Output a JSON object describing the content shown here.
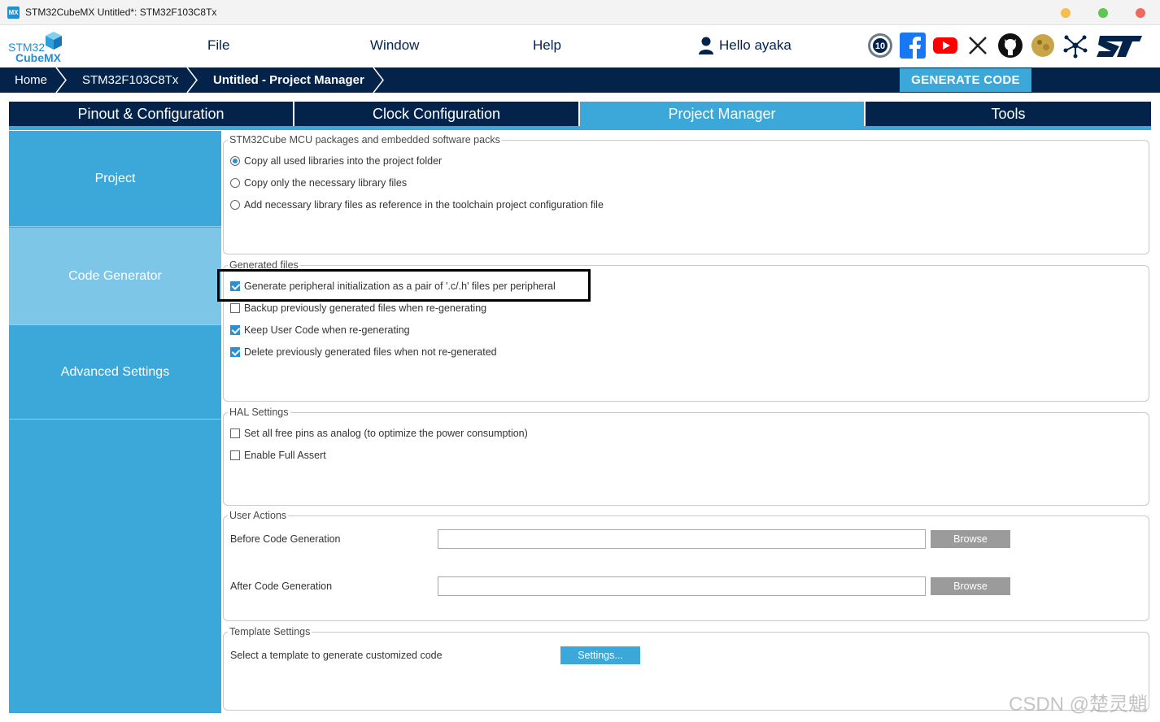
{
  "window": {
    "title": "STM32CubeMX Untitled*: STM32F103C8Tx",
    "icon_text": "MX",
    "controls": {
      "minimize_color": "#f5bf4f",
      "maximize_color": "#61c554",
      "close_color": "#ed6a5e"
    }
  },
  "logo": {
    "line1": "STM32",
    "line2": "CubeMX"
  },
  "menu": {
    "file": "File",
    "window": "Window",
    "help": "Help"
  },
  "user": {
    "greeting": "Hello ayaka",
    "icon": "user-icon"
  },
  "social_icons": [
    "10-years-badge-icon",
    "facebook-icon",
    "youtube-icon",
    "x-icon",
    "github-icon",
    "community-icon",
    "network-icon",
    "st-logo-icon"
  ],
  "breadcrumb": {
    "home": "Home",
    "mcu": "STM32F103C8Tx",
    "current": "Untitled - Project Manager"
  },
  "generate_button": "GENERATE CODE",
  "tabs": [
    {
      "label": "Pinout & Configuration",
      "active": false
    },
    {
      "label": "Clock Configuration",
      "active": false
    },
    {
      "label": "Project Manager",
      "active": true
    },
    {
      "label": "Tools",
      "active": false
    }
  ],
  "sidebar": {
    "items": [
      {
        "label": "Project",
        "active": false
      },
      {
        "label": "Code Generator",
        "active": true
      },
      {
        "label": "Advanced Settings",
        "active": false
      }
    ]
  },
  "groups": {
    "packages": {
      "title": "STM32Cube MCU packages and embedded software packs",
      "options": [
        {
          "label": "Copy all used libraries into the project folder",
          "selected": true
        },
        {
          "label": "Copy only the necessary library files",
          "selected": false
        },
        {
          "label": "Add necessary library files as reference in the toolchain project configuration file",
          "selected": false
        }
      ]
    },
    "generated": {
      "title": "Generated files",
      "options": [
        {
          "label": "Generate peripheral initialization as a pair of '.c/.h' files per peripheral",
          "checked": true
        },
        {
          "label": "Backup previously generated files when re-generating",
          "checked": false
        },
        {
          "label": "Keep User Code when re-generating",
          "checked": true
        },
        {
          "label": "Delete previously generated files when not re-generated",
          "checked": true
        }
      ]
    },
    "hal": {
      "title": "HAL Settings",
      "options": [
        {
          "label": "Set all free pins as analog (to optimize the power consumption)",
          "checked": false
        },
        {
          "label": "Enable Full Assert",
          "checked": false
        }
      ]
    },
    "user_actions": {
      "title": "User Actions",
      "before_label": "Before Code Generation",
      "before_value": "",
      "after_label": "After Code Generation",
      "after_value": "",
      "browse": "Browse"
    },
    "template": {
      "title": "Template Settings",
      "label": "Select a template to generate customized code",
      "button": "Settings..."
    }
  },
  "watermark": "CSDN @楚灵魈",
  "colors": {
    "navy": "#03234b",
    "accent": "#3ca7d9",
    "sidebar_active": "#7ec6e8",
    "check": "#2a8fd3"
  }
}
